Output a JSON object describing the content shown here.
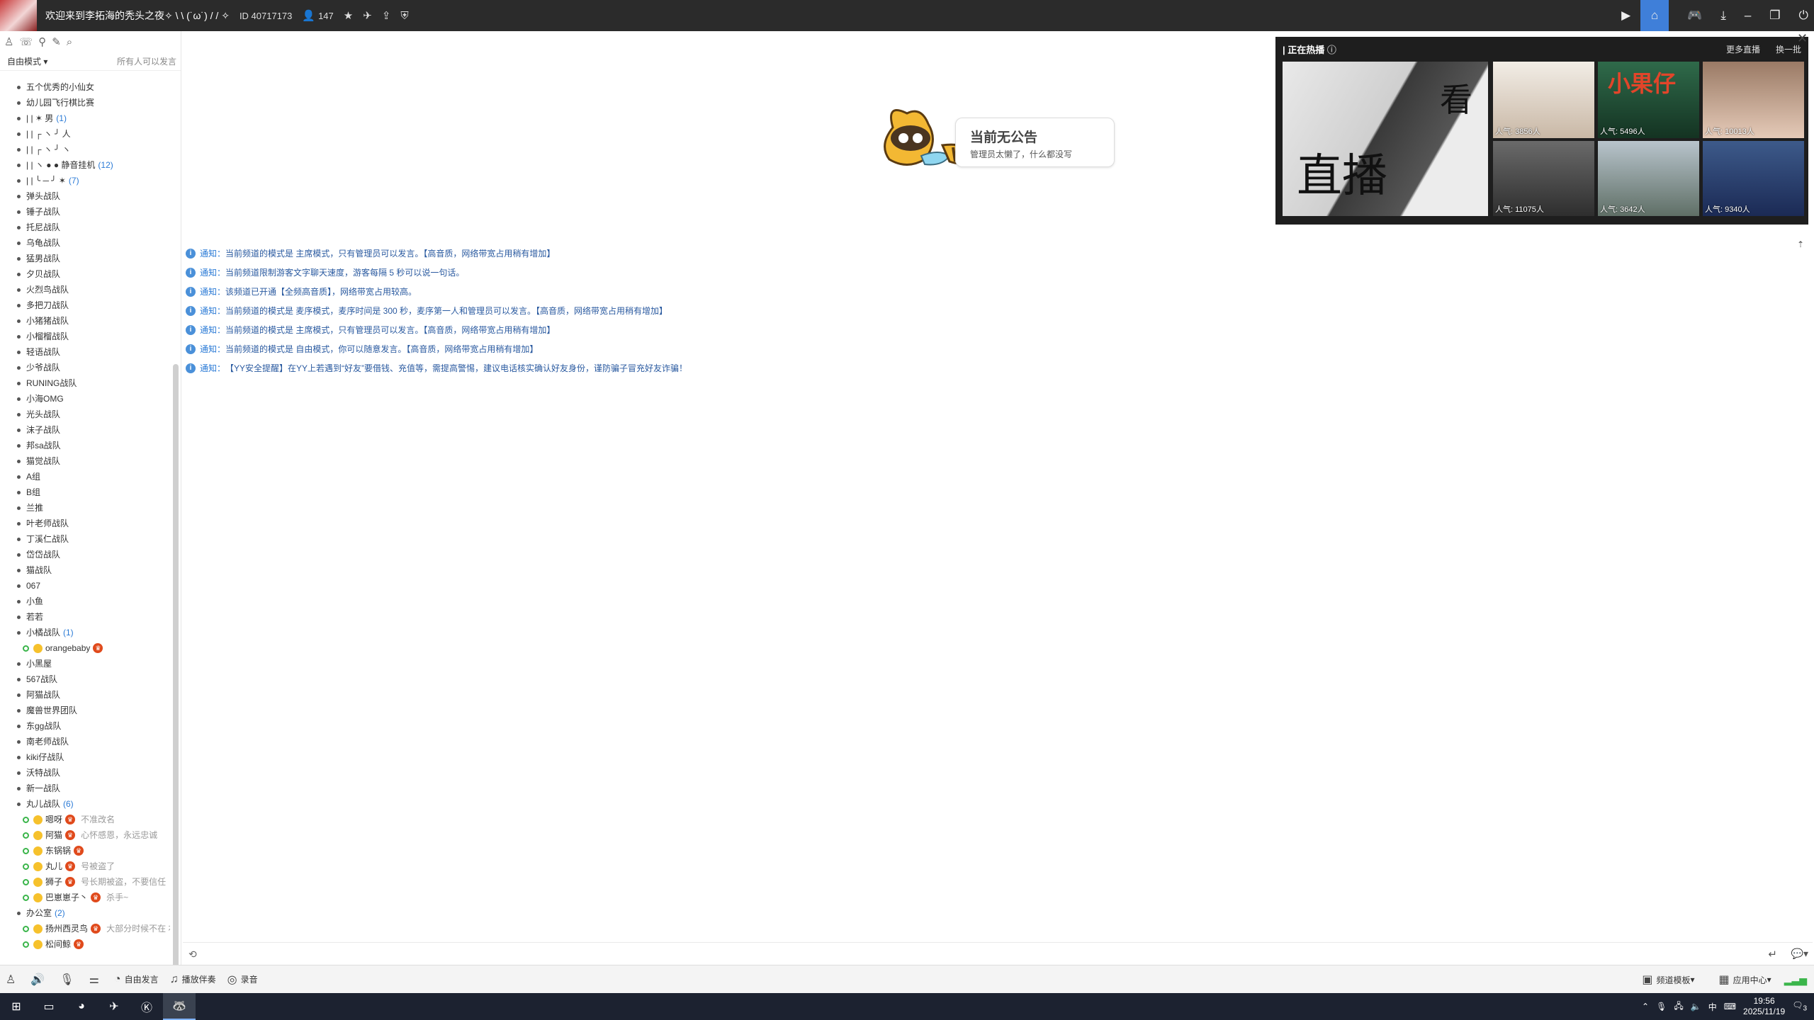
{
  "titlebar": {
    "title": "欢迎来到李拓海的秃头之夜✧ \\ \\ (˙ω˙) / / ✧",
    "channel_id": "ID 40717173",
    "user_count": "147",
    "icons": [
      "user-icon",
      "star-icon",
      "plane-icon",
      "share-icon",
      "shield-icon"
    ],
    "right_icons": [
      "video-icon",
      "home-icon",
      "gamepad-icon",
      "download-icon",
      "minimize-icon",
      "restore-icon",
      "power-icon"
    ]
  },
  "left": {
    "mode_label": "自由模式",
    "mode_right": "所有人可以发言",
    "toolbar_icons": [
      "person-icon",
      "chat-icon",
      "location-icon",
      "edit-icon",
      "search-icon"
    ],
    "tree": [
      {
        "label": "五个优秀的小仙女",
        "count": ""
      },
      {
        "label": "幼儿园飞行棋比赛",
        "count": ""
      },
      {
        "label": "| |    ✶           男",
        "count": "(1)"
      },
      {
        "label": "| |   ┌ ヽ ╯        人",
        "count": ""
      },
      {
        "label": "| | ┌ ヽ  ╯ ヽ",
        "count": ""
      },
      {
        "label": "| | ヽ  ●  ●   静音挂机",
        "count": "(12)"
      },
      {
        "label": "| |  ╰ ─ ╯  ✶",
        "count": "(7)"
      },
      {
        "label": "弹头战队",
        "count": ""
      },
      {
        "label": "锤子战队",
        "count": ""
      },
      {
        "label": "托尼战队",
        "count": ""
      },
      {
        "label": "乌龟战队",
        "count": ""
      },
      {
        "label": "猛男战队",
        "count": ""
      },
      {
        "label": "夕贝战队",
        "count": ""
      },
      {
        "label": "火烈鸟战队",
        "count": ""
      },
      {
        "label": "多把刀战队",
        "count": ""
      },
      {
        "label": "小猪猪战队",
        "count": ""
      },
      {
        "label": "小榴榴战队",
        "count": ""
      },
      {
        "label": "轻语战队",
        "count": ""
      },
      {
        "label": "少爷战队",
        "count": ""
      },
      {
        "label": "RUNING战队",
        "count": ""
      },
      {
        "label": "小海OMG",
        "count": ""
      },
      {
        "label": "光头战队",
        "count": ""
      },
      {
        "label": "沫子战队",
        "count": ""
      },
      {
        "label": "邦sa战队",
        "count": ""
      },
      {
        "label": "猫觉战队",
        "count": ""
      },
      {
        "label": "A组",
        "count": ""
      },
      {
        "label": "B组",
        "count": ""
      },
      {
        "label": "兰推",
        "count": ""
      },
      {
        "label": "叶老师战队",
        "count": ""
      },
      {
        "label": "丁溪仁战队",
        "count": ""
      },
      {
        "label": "岱岱战队",
        "count": ""
      },
      {
        "label": "猫战队",
        "count": ""
      },
      {
        "label": "067",
        "count": ""
      },
      {
        "label": "小鱼",
        "count": ""
      },
      {
        "label": "若若",
        "count": ""
      },
      {
        "label": "小橘战队",
        "count": "(1)"
      }
    ],
    "member_orange": {
      "name": "orangebaby",
      "sig": ""
    },
    "tree2": [
      {
        "label": "小黑屋",
        "count": ""
      },
      {
        "label": "567战队",
        "count": ""
      },
      {
        "label": "阿猫战队",
        "count": ""
      },
      {
        "label": "魔兽世界团队",
        "count": ""
      },
      {
        "label": "东gg战队",
        "count": ""
      },
      {
        "label": "南老师战队",
        "count": ""
      },
      {
        "label": "kiki仔战队",
        "count": ""
      },
      {
        "label": "沃特战队",
        "count": ""
      },
      {
        "label": "新一战队",
        "count": ""
      }
    ],
    "group_wanjia": {
      "label": "丸儿战队",
      "count": "(6)"
    },
    "members": [
      {
        "name": "嗯呀",
        "sig": "不准改名"
      },
      {
        "name": "阿猫",
        "sig": "心怀感恩，永远忠诚"
      },
      {
        "name": "东锅锅",
        "sig": ""
      },
      {
        "name": "丸儿",
        "sig": "号被盗了"
      },
      {
        "name": "狮子",
        "sig": "号长期被盗，不要信任"
      },
      {
        "name": "巴崽崽子丶",
        "sig": "杀手~"
      }
    ],
    "group_office": {
      "label": "办公室",
      "count": "(2)"
    },
    "office_members": [
      {
        "name": "扬州西灵鸟",
        "sig": "大部分时候不在 右"
      },
      {
        "name": "松间鲸",
        "sig": ""
      }
    ]
  },
  "announcement": {
    "title": "当前无公告",
    "subtitle": "管理员太懒了，什么都没写"
  },
  "notices": [
    {
      "prefix": "通知：",
      "text": "当前频道的模式是 主席模式，只有管理员可以发言。【高音质，网络带宽占用稍有增加】"
    },
    {
      "prefix": "通知：",
      "text": "当前频道限制游客文字聊天速度，游客每隔 5 秒可以说一句话。"
    },
    {
      "prefix": "通知：",
      "text": "该频道已开通【全频高音质】，网络带宽占用较高。"
    },
    {
      "prefix": "通知：",
      "text": "当前频道的模式是 麦序模式，麦序时间是 300 秒，麦序第一人和管理员可以发言。【高音质，网络带宽占用稍有增加】"
    },
    {
      "prefix": "通知：",
      "text": "当前频道的模式是 主席模式，只有管理员可以发言。【高音质，网络带宽占用稍有增加】"
    },
    {
      "prefix": "通知：",
      "text": "当前频道的模式是 自由模式，你可以随意发言。【高音质，网络带宽占用稍有增加】"
    },
    {
      "prefix": "通知：",
      "text": "【YY安全提醒】在YY上若遇到“好友”要借钱、充值等，需提高警惕，建议电话核实确认好友身份，谨防骗子冒充好友诈骗！"
    }
  ],
  "hot": {
    "title": "正在热播",
    "more": "更多直播",
    "swap": "换一批",
    "big_text": "直播",
    "big_text2": "看",
    "items": [
      {
        "pop": "人气: 3856人"
      },
      {
        "pop": "人气: 5496人",
        "overlay": "小果仔"
      },
      {
        "pop": "人气: 10013人"
      },
      {
        "pop": "人气: 11075人"
      },
      {
        "pop": "人气: 3642人"
      },
      {
        "pop": "人气: 9340人"
      }
    ]
  },
  "bottom": {
    "free_speak": "自由发言",
    "accompany": "播放伴奏",
    "record": "录音",
    "template": "频道模板",
    "app_center": "应用中心"
  },
  "taskbar": {
    "time": "19:56",
    "date": "2025/11/19",
    "ime": "中",
    "notif_count": "3"
  }
}
